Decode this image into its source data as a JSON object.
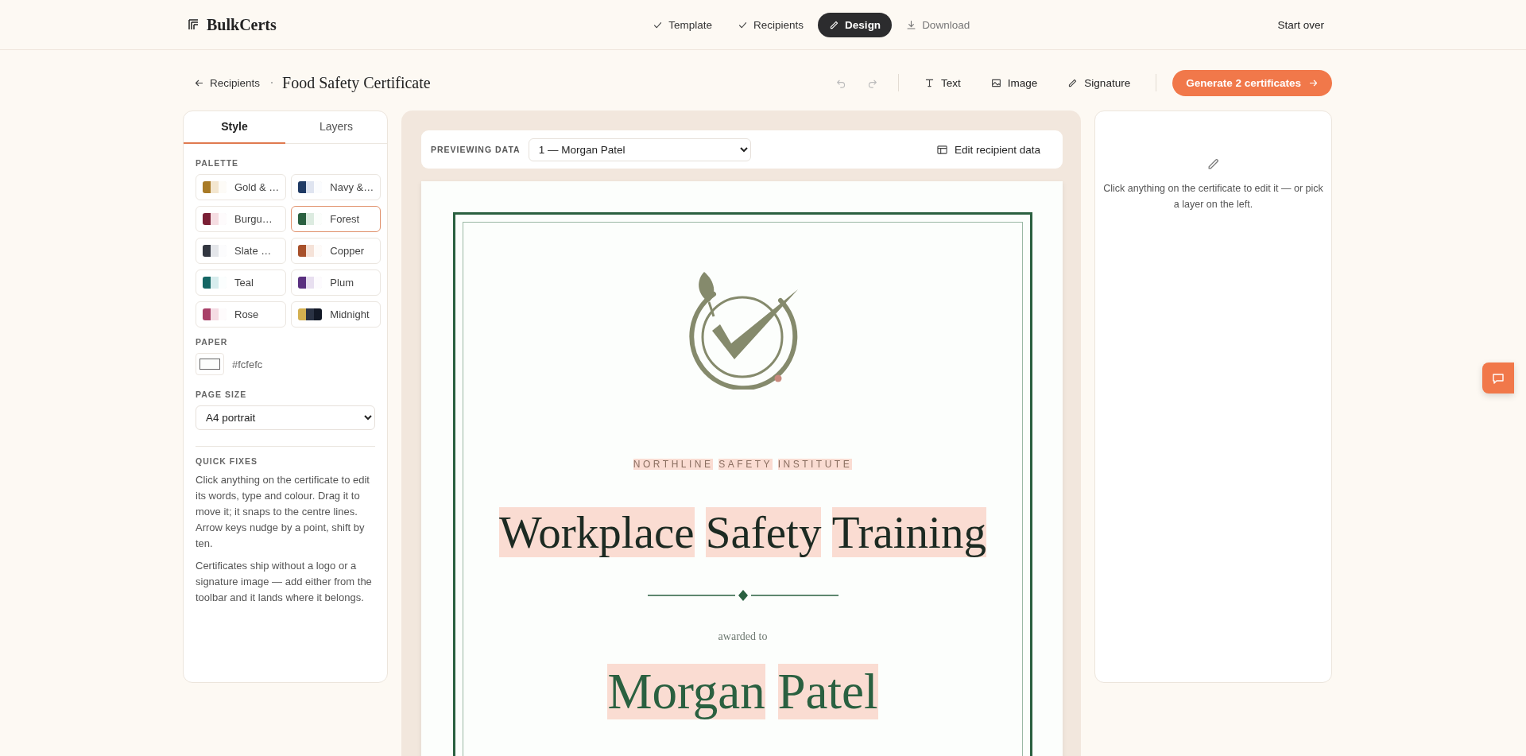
{
  "app": {
    "name": "BulkCerts"
  },
  "steps": [
    {
      "label": "Template",
      "kind": "done",
      "selected": false
    },
    {
      "label": "Recipients",
      "kind": "done",
      "selected": false
    },
    {
      "label": "Design",
      "kind": "current",
      "selected": true
    },
    {
      "label": "Download",
      "kind": "pending",
      "selected": false
    }
  ],
  "start_over": "Start over",
  "toolbar": {
    "back": "Recipients",
    "title": "Food Safety Certificate",
    "undo_disabled": true,
    "redo_disabled": true,
    "tools": [
      {
        "kind": "text",
        "label": "Text"
      },
      {
        "kind": "image",
        "label": "Image"
      },
      {
        "kind": "signature",
        "label": "Signature"
      }
    ],
    "generate": "Generate 2 certificates"
  },
  "sidebar": {
    "tabs": [
      {
        "label": "Style",
        "selected": true
      },
      {
        "label": "Layers",
        "selected": false
      }
    ],
    "palette_heading": "PALETTE",
    "palettes": [
      {
        "label": "Gold & …",
        "selected": false,
        "swatch": [
          {
            "color": "#a87a26"
          },
          {
            "color": "#f3e6cf"
          },
          {
            "color": "#fdfbf7"
          }
        ]
      },
      {
        "label": "Navy &…",
        "selected": false,
        "swatch": [
          {
            "color": "#1f3a64"
          },
          {
            "color": "#dfe4f0"
          },
          {
            "color": "#fbfcfe"
          }
        ]
      },
      {
        "label": "Burgu…",
        "selected": false,
        "swatch": [
          {
            "color": "#7a1f35"
          },
          {
            "color": "#f5dde2"
          },
          {
            "color": "#fefbfc"
          }
        ]
      },
      {
        "label": "Forest",
        "selected": true,
        "swatch": [
          {
            "color": "#2a6040"
          },
          {
            "color": "#dcebe0"
          },
          {
            "color": "#fcfefc"
          }
        ]
      },
      {
        "label": "Slate …",
        "selected": false,
        "swatch": [
          {
            "color": "#323640"
          },
          {
            "color": "#e4e6ea"
          },
          {
            "color": "#fcfcfd"
          }
        ]
      },
      {
        "label": "Copper",
        "selected": false,
        "swatch": [
          {
            "color": "#a8502a"
          },
          {
            "color": "#f5e2d8"
          },
          {
            "color": "#fefbf9"
          }
        ]
      },
      {
        "label": "Teal",
        "selected": false,
        "swatch": [
          {
            "color": "#156664"
          },
          {
            "color": "#d7edee"
          },
          {
            "color": "#fbfefe"
          }
        ]
      },
      {
        "label": "Plum",
        "selected": false,
        "swatch": [
          {
            "color": "#5a3080"
          },
          {
            "color": "#e8dff0"
          },
          {
            "color": "#fdfbfe"
          }
        ]
      },
      {
        "label": "Rose",
        "selected": false,
        "swatch": [
          {
            "color": "#a84068"
          },
          {
            "color": "#f5dce4"
          },
          {
            "color": "#fefbfc"
          }
        ]
      },
      {
        "label": "Midnight",
        "selected": false,
        "swatch": [
          {
            "color": "#d4b050"
          },
          {
            "color": "#2a3244"
          },
          {
            "color": "#121826"
          }
        ]
      }
    ],
    "paper": {
      "heading": "PAPER",
      "value": "#fcfefc",
      "color": "#fcfefc"
    },
    "page_size": {
      "heading": "PAGE SIZE",
      "value": "A4 portrait"
    },
    "quick_fixes": {
      "heading": "QUICK FIXES",
      "paragraphs": [
        "Click anything on the certificate to edit its words, type and colour. Drag it to move it; it snaps to the centre lines. Arrow keys nudge by a point, shift by ten.",
        "Certificates ship without a logo or a signature image — add either from the toolbar and it lands where it belongs."
      ]
    }
  },
  "preview": {
    "label": "PREVIEWING DATA",
    "recipient": "1 — Morgan Patel",
    "edit": "Edit recipient data"
  },
  "certificate": {
    "organization": {
      "text": "NORTHLINE SAFETY INSTITUTE",
      "highlighted": true
    },
    "title": {
      "text": "Workplace Safety Training",
      "highlighted": true
    },
    "awarded": {
      "text": "awarded to",
      "highlighted": false
    },
    "recipient": {
      "text": "Morgan Patel",
      "highlighted": true
    }
  },
  "inspector": {
    "hint": "Click anything on the certificate to edit it — or pick a layer on the left."
  }
}
